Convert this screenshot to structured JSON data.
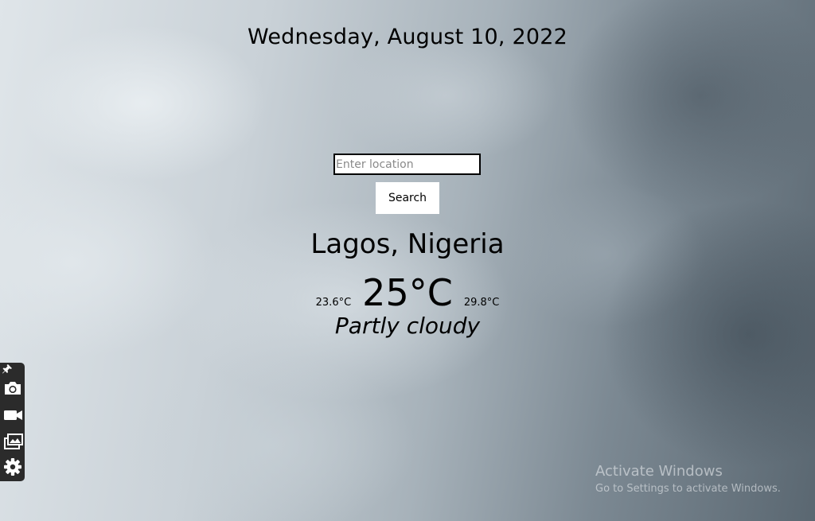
{
  "header": {
    "date": "Wednesday, August 10, 2022"
  },
  "search": {
    "placeholder": "Enter location",
    "value": "",
    "button_label": "Search"
  },
  "weather": {
    "location": "Lagos, Nigeria",
    "min_temp": "23.6°C",
    "current_temp": "25°C",
    "max_temp": "29.8°C",
    "condition": "Partly cloudy"
  },
  "side_toolbar": {
    "icons": [
      "pin-icon",
      "camera-icon",
      "video-camera-icon",
      "gallery-icon",
      "gear-icon"
    ],
    "background_color": "#2b2b2b",
    "icon_color": "#ffffff"
  },
  "watermark": {
    "title": "Activate Windows",
    "subtitle": "Go to Settings to activate Windows."
  }
}
